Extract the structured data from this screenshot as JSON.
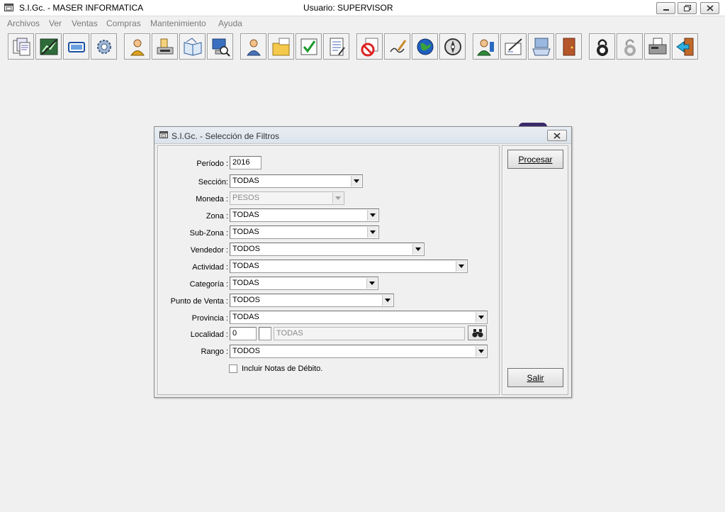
{
  "window": {
    "title": "S.I.Gc. - MASER INFORMATICA",
    "user": "Usuario: SUPERVISOR"
  },
  "menu": [
    "Archivos",
    "Ver",
    "Ventas",
    "Compras",
    "Mantenimiento",
    "Ayuda"
  ],
  "toolbar_icons": [
    "documents-icon",
    "ledger-icon",
    "card-icon",
    "gear-icon",
    "user-icon",
    "printer-icon",
    "book-icon",
    "computer-search-icon",
    "person-icon",
    "folder-icon",
    "checklist-icon",
    "notes-icon",
    "prohibited-icon",
    "signature-icon",
    "globe-icon",
    "compass-icon",
    "people-icon",
    "edit-icon",
    "keyboard-icon",
    "door-icon",
    "lock-icon",
    "unlock-icon",
    "fax-icon",
    "exit-icon"
  ],
  "dialog": {
    "title": "S.I.Gc. - Selección de Filtros",
    "labels": {
      "periodo": "Período :",
      "seccion": "Sección:",
      "moneda": "Moneda :",
      "zona": "Zona :",
      "subzona": "Sub-Zona :",
      "vendedor": "Vendedor :",
      "actividad": "Actividad :",
      "categoria": "Categoría :",
      "punto_venta": "Punto de Venta :",
      "provincia": "Provincia :",
      "localidad": "Localidad :",
      "rango": "Rango :"
    },
    "values": {
      "periodo": "2016",
      "seccion": "TODAS",
      "moneda": "PESOS",
      "zona": "TODAS",
      "subzona": "TODAS",
      "vendedor": "TODOS",
      "actividad": "TODAS",
      "categoria": "TODAS",
      "punto_venta": "TODOS",
      "provincia": "TODAS",
      "localidad_code": "0",
      "localidad_sub": "",
      "localidad_name": "TODAS",
      "rango": "TODOS"
    },
    "checkbox_label": "Incluir Notas de Débito.",
    "checkbox_checked": false,
    "buttons": {
      "procesar": "Procesar",
      "salir": "Salir"
    }
  }
}
